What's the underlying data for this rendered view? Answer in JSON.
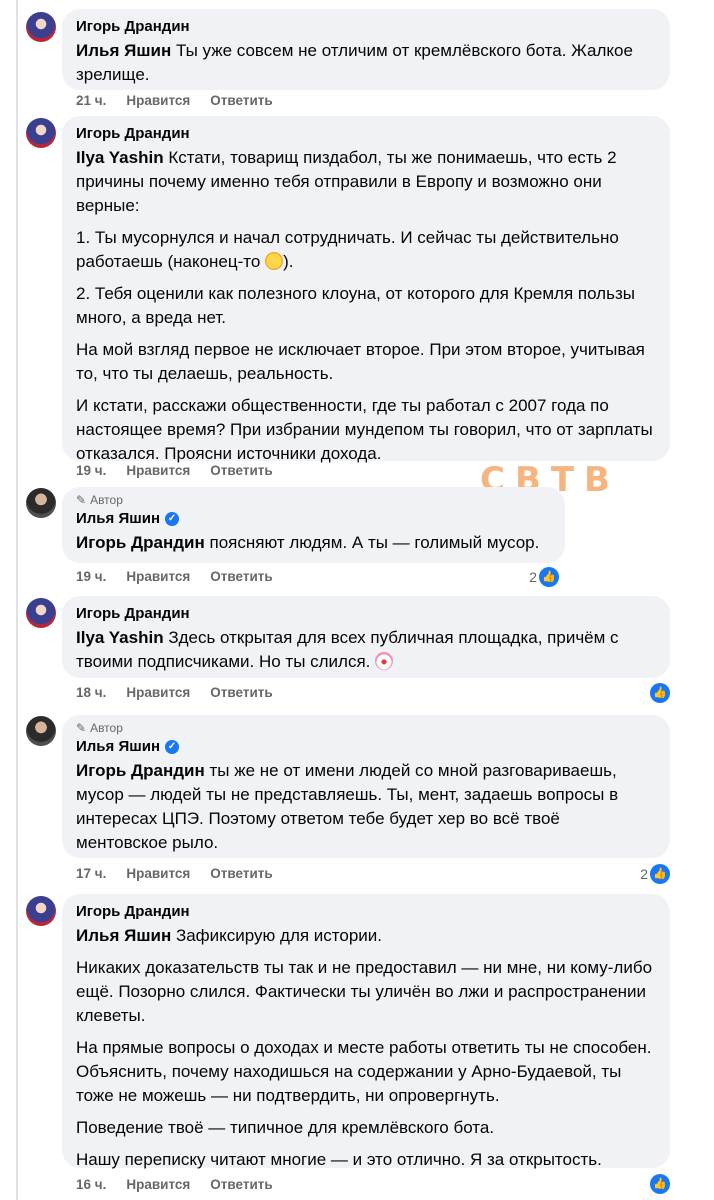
{
  "comments": [
    {
      "author": "Игорь Драндин",
      "mention": "Илья Яшин",
      "paragraphs": [
        "Ты уже совсем не отличим от кремлёвского бота. Жалкое зрелище."
      ],
      "time": "21 ч.",
      "like_label": "Нравится",
      "reply_label": "Ответить"
    },
    {
      "author": "Игорь Драндин",
      "mention": "Ilya Yashin",
      "paragraphs": [
        "Кстати, товарищ пиздабол, ты же понимаешь, что есть 2 причины почему именно тебя отправили в Европу и возможно они верные:",
        "1. Ты мусорнулся и начал сотрудничать. И сейчас ты действительно работаешь (наконец-то",
        "2. Тебя оценили как полезного клоуна, от которого для Кремля пользы много, а вреда нет.",
        "На мой взгляд первое не исключает второе. При этом второе, учитывая то, что ты делаешь, реальность.",
        "И кстати, расскажи общественности, где ты работал с 2007 года по настоящее время? При избрании мундепом ты говорил, что от зарплаты отказался. Проясни источники дохода."
      ],
      "time": "19 ч.",
      "like_label": "Нравится",
      "reply_label": "Ответить"
    },
    {
      "author_tag": "Автор",
      "author": "Илья Яшин",
      "mention": "Игорь Драндин",
      "paragraphs": [
        "поясняют людям. А ты — голимый мусор."
      ],
      "time": "19 ч.",
      "like_label": "Нравится",
      "reply_label": "Ответить",
      "likes": "2"
    },
    {
      "author": "Игорь Драндин",
      "mention": "Ilya Yashin",
      "paragraphs": [
        "Здесь открытая для всех публичная площадка, причём с твоими подписчиками. Но ты слился."
      ],
      "time": "18 ч.",
      "like_label": "Нравится",
      "reply_label": "Ответить",
      "likes": ""
    },
    {
      "author_tag": "Автор",
      "author": "Илья Яшин",
      "mention": "Игорь Драндин",
      "paragraphs": [
        "ты же не от имени людей со мной разговариваешь, мусор — людей ты не представляешь. Ты, мент, задаешь вопросы в интересах ЦПЭ. Поэтому ответом тебе будет хер во всё твоё ментовское рыло."
      ],
      "time": "17 ч.",
      "like_label": "Нравится",
      "reply_label": "Ответить",
      "likes": "2"
    },
    {
      "author": "Игорь Драндин",
      "mention": "Илья Яшин",
      "paragraphs": [
        "Зафиксирую для истории.",
        "Никаких доказательств ты так и не предоставил — ни мне, ни кому-либо ещё. Позорно слился. Фактически ты уличён во лжи и распространении клеветы.",
        "На прямые вопросы о доходах и месте работы ответить ты не способен. Объяснить, почему находишься на содержании у Арно-Будаевой, ты тоже не можешь — ни подтвердить, ни опровергнуть.",
        "Поведение твоё — типичное для кремлёвского бота.",
        "Нашу переписку читают многие — и это отлично. Я за открытость."
      ],
      "time": "16 ч.",
      "like_label": "Нравится",
      "reply_label": "Ответить",
      "likes": ""
    }
  ],
  "text_after_emoji": ").",
  "watermark": "СВТВ",
  "colors": {
    "bubble": "#f0f2f5",
    "meta": "#65676b",
    "like_blue": "#1877f2"
  }
}
